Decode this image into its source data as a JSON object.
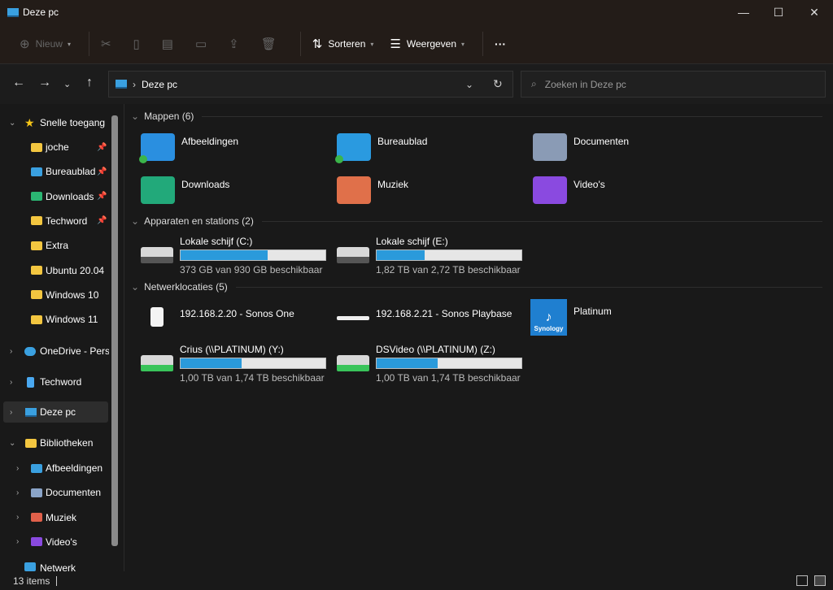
{
  "window": {
    "title": "Deze pc",
    "minimize": "—",
    "maximize": "☐",
    "close": "✕"
  },
  "toolbar": {
    "new_label": "Nieuw",
    "sort_label": "Sorteren",
    "view_label": "Weergeven",
    "more": "···"
  },
  "nav": {
    "breadcrumb": "Deze pc",
    "search_placeholder": "Zoeken in Deze pc"
  },
  "sidebar": {
    "quick_access": "Snelle toegang",
    "quick_items": [
      {
        "label": "joche",
        "pinned": true,
        "color": "#f3c640"
      },
      {
        "label": "Bureaublad",
        "pinned": true,
        "color": "#3aa0e0"
      },
      {
        "label": "Downloads",
        "pinned": true,
        "color": "#2bb673"
      },
      {
        "label": "Techword",
        "pinned": true,
        "color": "#f3c640"
      },
      {
        "label": "Extra",
        "color": "#f3c640"
      },
      {
        "label": "Ubuntu 20.04",
        "color": "#f3c640"
      },
      {
        "label": "Windows 10",
        "color": "#f3c640"
      },
      {
        "label": "Windows 11",
        "color": "#f3c640"
      }
    ],
    "onedrive": "OneDrive - Perso",
    "techword": "Techword",
    "this_pc": "Deze pc",
    "libraries": "Bibliotheken",
    "library_items": [
      {
        "label": "Afbeeldingen",
        "color": "#3aa0e0"
      },
      {
        "label": "Documenten",
        "color": "#8aa4c8"
      },
      {
        "label": "Muziek",
        "color": "#e0604a"
      },
      {
        "label": "Video's",
        "color": "#8a4ae0"
      }
    ],
    "network": "Netwerk"
  },
  "main": {
    "folders_header": "Mappen (6)",
    "folders": [
      {
        "label": "Afbeeldingen",
        "color": "#2a8fe0",
        "synced": true
      },
      {
        "label": "Bureaublad",
        "color": "#2a9ae0",
        "synced": true
      },
      {
        "label": "Documenten",
        "color": "#8a9bb5"
      },
      {
        "label": "Downloads",
        "color": "#22a97a"
      },
      {
        "label": "Muziek",
        "color": "#e0704a"
      },
      {
        "label": "Video's",
        "color": "#8a4ae0"
      }
    ],
    "devices_header": "Apparaten en stations (2)",
    "drives": [
      {
        "label": "Lokale schijf (C:)",
        "info": "373 GB van 930 GB beschikbaar",
        "used_percent": 60
      },
      {
        "label": "Lokale schijf (E:)",
        "info": "1,82 TB van 2,72 TB beschikbaar",
        "used_percent": 33
      }
    ],
    "network_header": "Netwerklocaties (5)",
    "network_devices": [
      {
        "label": "192.168.2.20 - Sonos One"
      },
      {
        "label": "192.168.2.21 - Sonos Playbase"
      },
      {
        "label": "Platinum",
        "logo": "Synology"
      }
    ],
    "network_drives": [
      {
        "label": "Crius (\\\\PLATINUM) (Y:)",
        "info": "1,00 TB van 1,74 TB beschikbaar",
        "used_percent": 42
      },
      {
        "label": "DSVideo (\\\\PLATINUM) (Z:)",
        "info": "1,00 TB van 1,74 TB beschikbaar",
        "used_percent": 42
      }
    ]
  },
  "status": {
    "count": "13 items"
  }
}
